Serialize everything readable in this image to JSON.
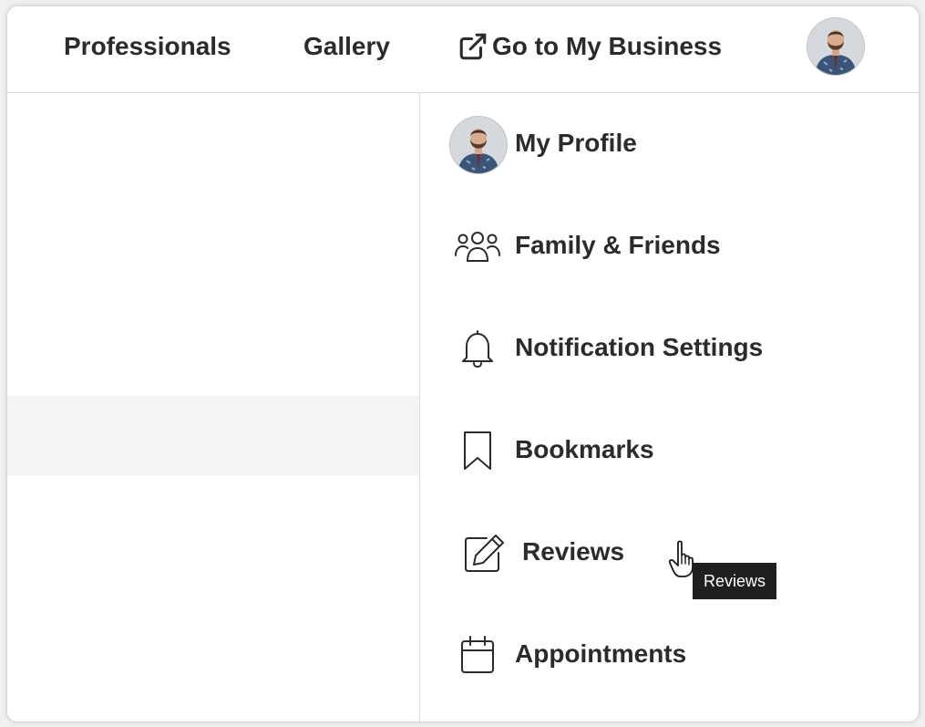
{
  "nav": {
    "professionals": "Professionals",
    "gallery": "Gallery",
    "go_to_business": "Go to My Business",
    "go_to_business_icon": "external-link-icon",
    "avatar_icon": "user-avatar"
  },
  "menu": {
    "items": [
      {
        "label": "My Profile",
        "icon": "user-avatar"
      },
      {
        "label": "Family & Friends",
        "icon": "group-icon"
      },
      {
        "label": "Notification Settings",
        "icon": "bell-icon"
      },
      {
        "label": "Bookmarks",
        "icon": "bookmark-icon"
      },
      {
        "label": "Reviews",
        "icon": "edit-icon"
      },
      {
        "label": "Appointments",
        "icon": "calendar-icon"
      }
    ],
    "hovered_item": "Reviews"
  },
  "tooltip": {
    "text": "Reviews"
  },
  "colors": {
    "text": "#2b2b2b",
    "border": "#dcdcdc",
    "highlight_row": "#f4f4f4",
    "tooltip_bg": "#1f1f1f",
    "tooltip_text": "#ffffff"
  }
}
